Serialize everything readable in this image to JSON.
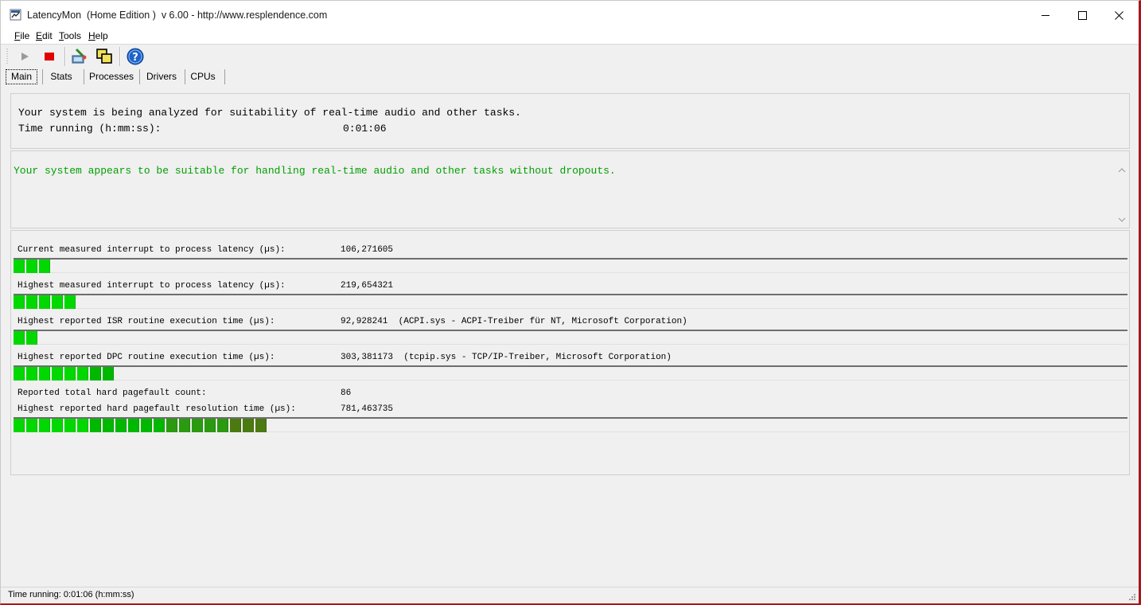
{
  "window": {
    "title": "LatencyMon  (Home Edition )  v 6.00 - http://www.resplendence.com",
    "app_icon": "latencymon-icon",
    "controls": [
      "minimize-icon",
      "maximize-icon",
      "close-icon"
    ]
  },
  "menu": {
    "items": [
      {
        "underline": "F",
        "rest": "ile"
      },
      {
        "underline": "E",
        "rest": "dit"
      },
      {
        "underline": "T",
        "rest": "ools"
      },
      {
        "underline": "H",
        "rest": "elp"
      }
    ]
  },
  "toolbar": {
    "icons": [
      "play-icon",
      "stop-icon",
      "cleanup-icon",
      "windows-icon",
      "help-icon"
    ],
    "colors": {
      "stop": "#e00000",
      "help": "#1e64c8"
    }
  },
  "tabs": [
    {
      "label": "Main",
      "active": true
    },
    {
      "label": "Stats"
    },
    {
      "label": "Processes"
    },
    {
      "label": "Drivers"
    },
    {
      "label": "CPUs"
    }
  ],
  "status": {
    "line1": "Your system is being analyzed for suitability of real-time audio and other tasks.",
    "line2": "Time running (h:mm:ss):",
    "time_value": "0:01:06"
  },
  "verdict": {
    "text": "Your system appears to be suitable for handling real-time audio and other tasks without dropouts.",
    "color": "#00a000"
  },
  "metrics": [
    {
      "label": "Current measured interrupt to process latency (µs):",
      "value": "106,271605",
      "bar_segments": 3
    },
    {
      "label": "Highest measured interrupt to process latency (µs):",
      "value": "219,654321",
      "bar_segments": 5
    },
    {
      "label": "Highest reported ISR routine execution time (µs):",
      "value": "92,928241  (ACPI.sys - ACPI-Treiber für NT, Microsoft Corporation)",
      "bar_segments": 2
    },
    {
      "label": "Highest reported DPC routine execution time (µs):",
      "value": "303,381173  (tcpip.sys - TCP/IP-Treiber, Microsoft Corporation)",
      "bar_segments": 8
    },
    {
      "label": "Reported total hard pagefault count:",
      "value": "86",
      "bar_segments": null
    },
    {
      "label": "Highest reported hard pagefault resolution time (µs):",
      "value": "781,463735",
      "bar_segments": 20
    }
  ],
  "bar_colors": [
    "#00d800",
    "#00b800",
    "#2a9a10",
    "#4a7a10"
  ],
  "statusbar": {
    "text": "Time running: 0:01:06  (h:mm:ss)"
  }
}
